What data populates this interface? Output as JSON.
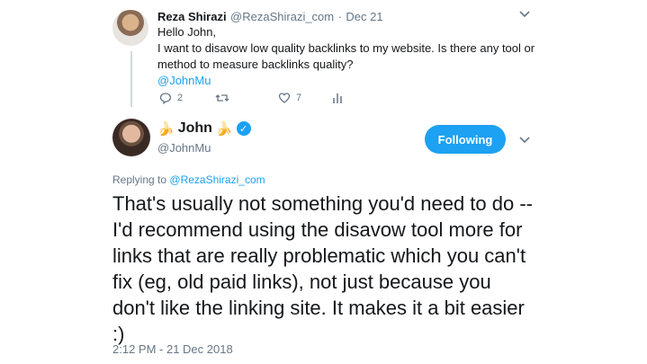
{
  "reply_tweet": {
    "author_name": "Reza Shirazi",
    "author_handle": "@RezaShirazi_com",
    "separator": "·",
    "date": "Dec 21",
    "text_lines": [
      "Hello John,",
      "I want to disavow low quality  backlinks to my website. Is there any tool or",
      "method to measure backlinks quality?"
    ],
    "mention": "@JohnMu",
    "actions": {
      "reply_count": "2",
      "retweet_count": "",
      "like_count": "7"
    }
  },
  "main_tweet": {
    "author_name": "John",
    "author_handle": "@JohnMu",
    "emoji_left": "🍌",
    "emoji_right": "🍌",
    "follow_button": "Following",
    "replying_to_prefix": "Replying to",
    "replying_to_handle": "@RezaShirazi_com",
    "text": "That's usually not something you'd need to do -- I'd recommend using the disavow tool more for links that are really problematic which you can't fix (eg, old paid links), not just because you don't like the linking site. It makes it a bit easier :)",
    "timestamp": "2:12 PM - 21 Dec 2018"
  },
  "colors": {
    "accent": "#1da1f2",
    "muted": "#657786",
    "text": "#14171a"
  }
}
